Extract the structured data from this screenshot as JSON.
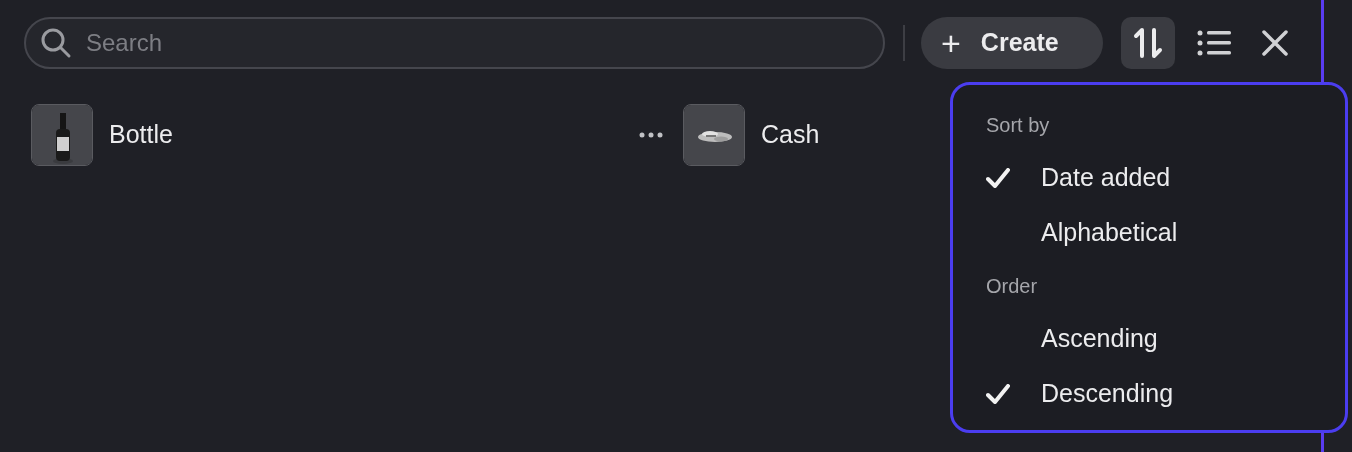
{
  "search": {
    "placeholder": "Search"
  },
  "create_button": {
    "icon": "+",
    "label": "Create"
  },
  "items": [
    {
      "name": "Bottle",
      "kind": "bottle",
      "hovered": true
    },
    {
      "name": "Cash",
      "kind": "cash",
      "hovered": false
    }
  ],
  "sort_menu": {
    "sections": [
      {
        "title": "Sort by",
        "options": [
          {
            "label": "Date added",
            "selected": true
          },
          {
            "label": "Alphabetical",
            "selected": false
          }
        ]
      },
      {
        "title": "Order",
        "options": [
          {
            "label": "Ascending",
            "selected": false
          },
          {
            "label": "Descending",
            "selected": true
          }
        ]
      }
    ]
  }
}
